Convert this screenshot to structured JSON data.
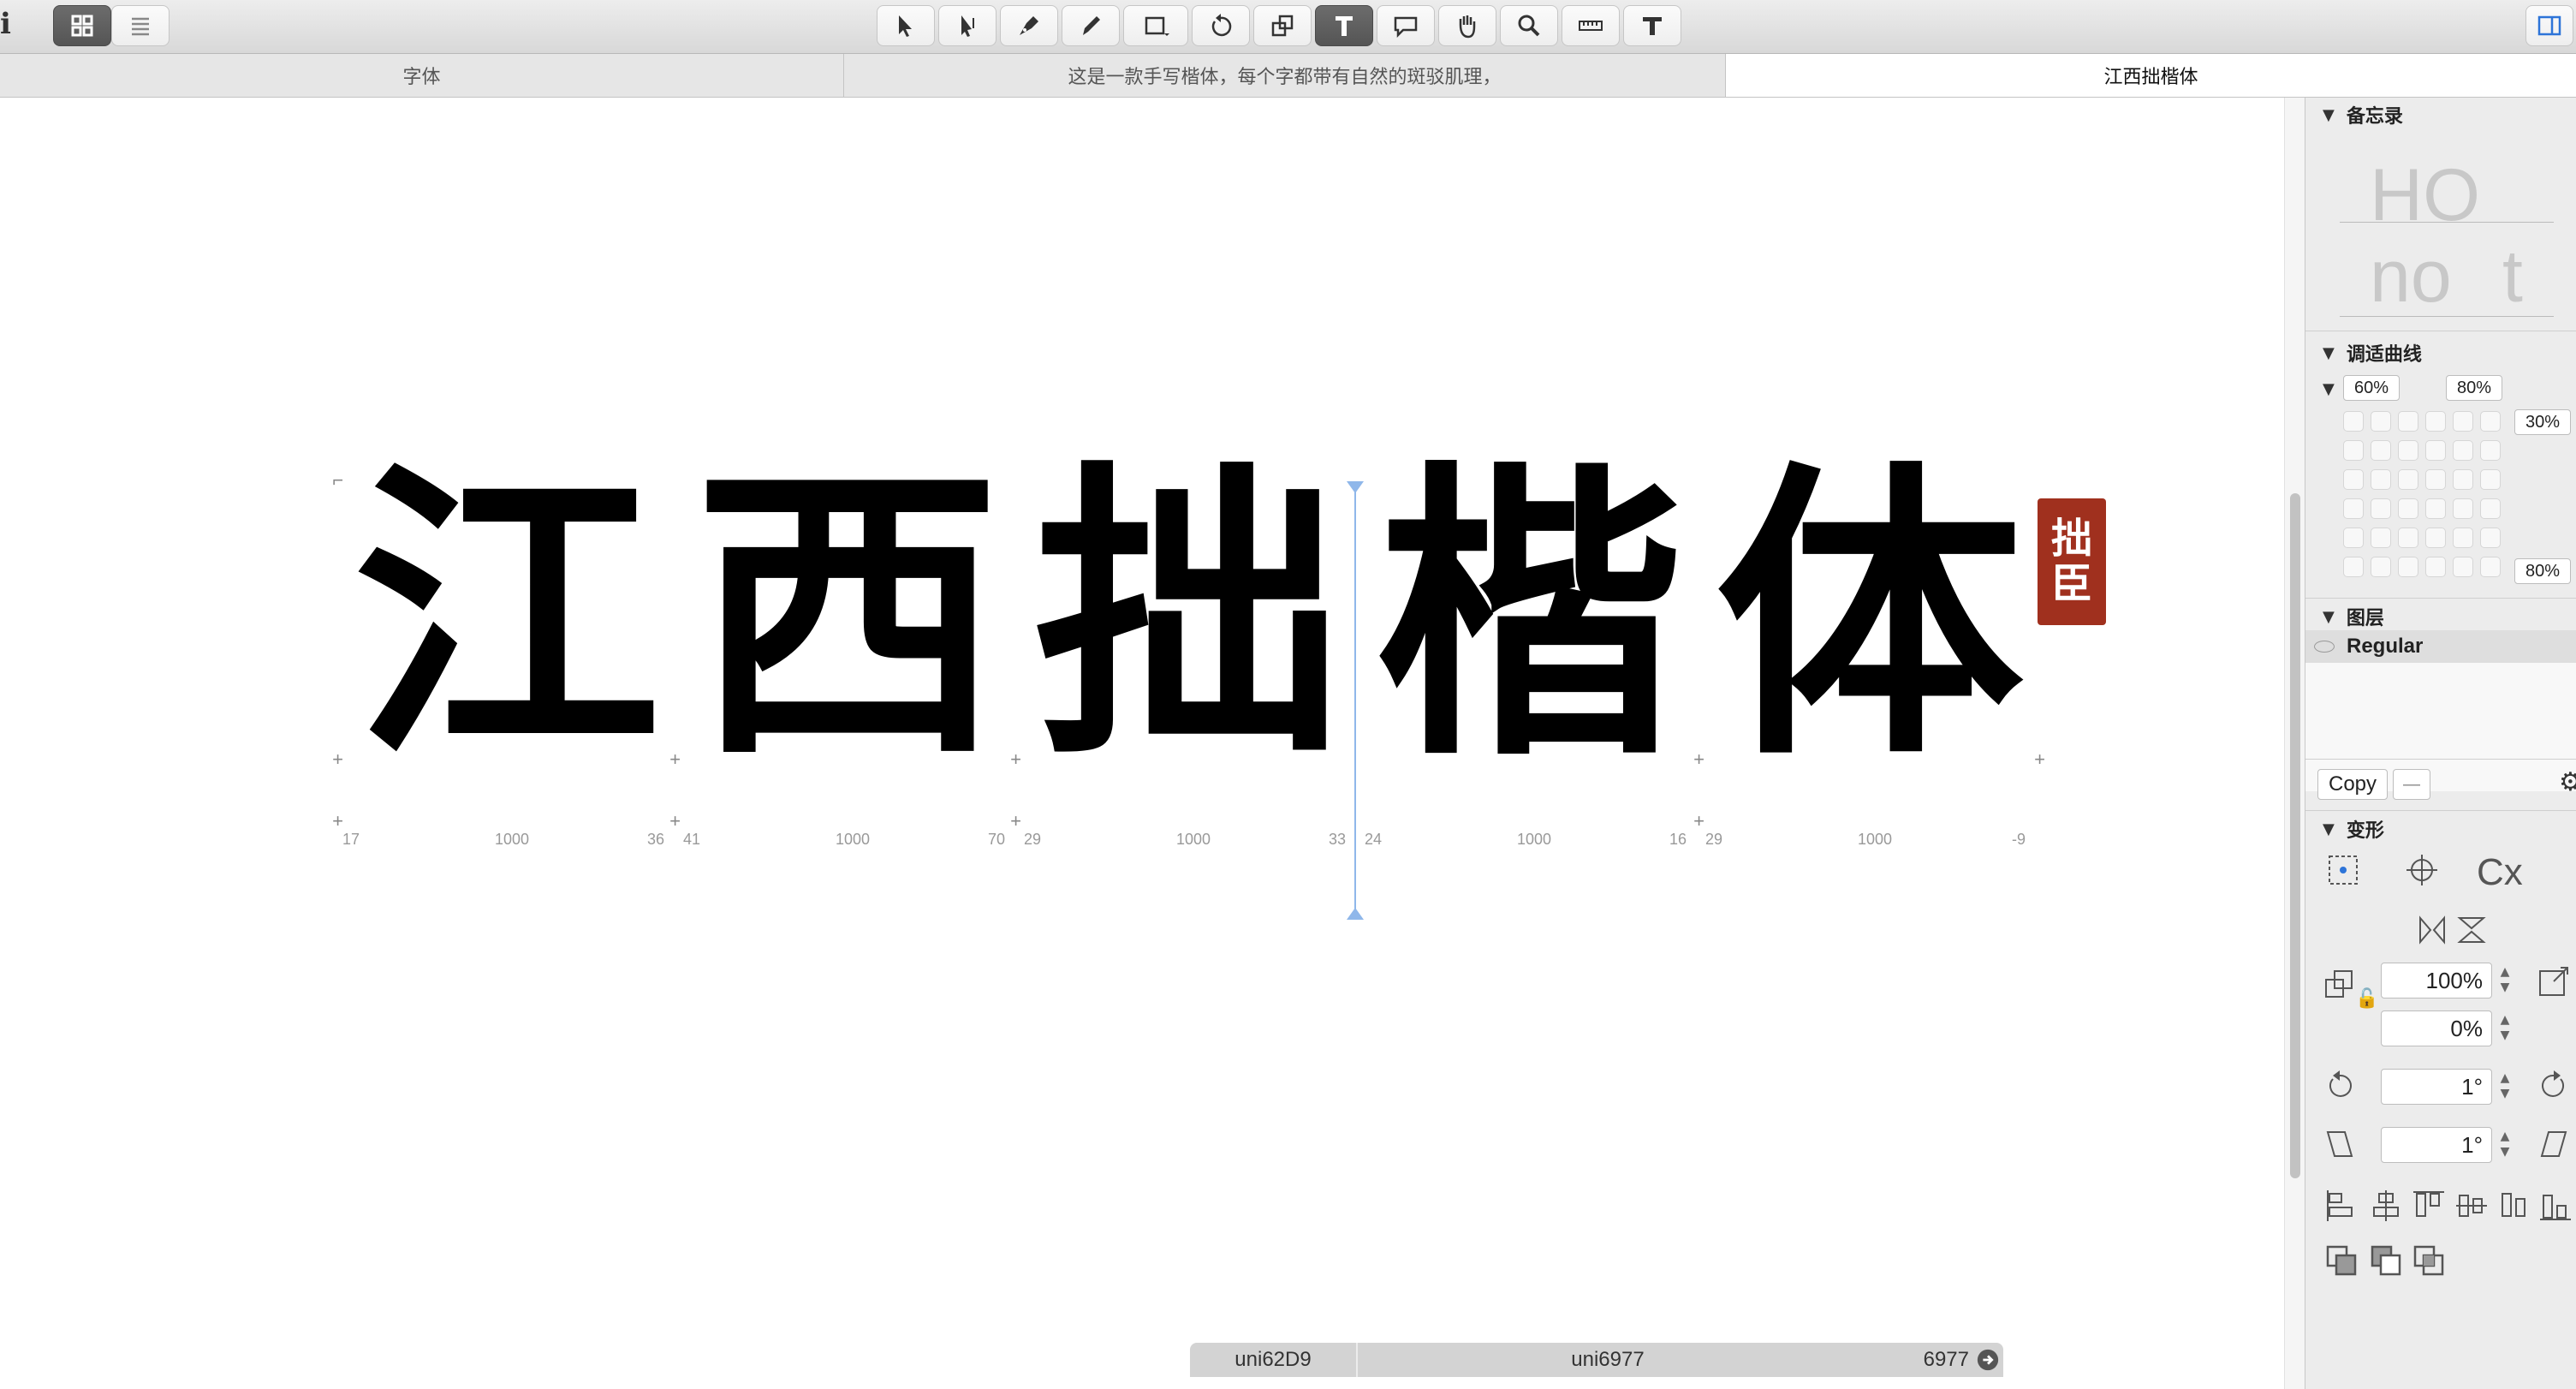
{
  "toolbar": {
    "info_glyph": "i",
    "view_buttons": [
      "grid-view",
      "list-view"
    ],
    "tools": [
      "select",
      "select-all-layers",
      "draw",
      "pencil",
      "primitives",
      "rotate",
      "scale",
      "text",
      "annotate",
      "hand",
      "zoom",
      "measure",
      "erase"
    ],
    "active_tool": "text"
  },
  "tabs": [
    {
      "label": "字体"
    },
    {
      "label": "这是一款手写楷体，每个字都带有自然的斑驳肌理，"
    },
    {
      "label": "江西拙楷体"
    }
  ],
  "canvas": {
    "glyphs": [
      "江",
      "西",
      "拙",
      "楷",
      "体"
    ],
    "metrics": [
      {
        "lsb": "17",
        "width": "1000",
        "rsb": "36"
      },
      {
        "lsb": "41",
        "width": "1000",
        "rsb": "70"
      },
      {
        "lsb": "29",
        "width": "1000",
        "rsb": "33"
      },
      {
        "lsb": "24",
        "width": "1000",
        "rsb": "16"
      },
      {
        "lsb": "29",
        "width": "1000",
        "rsb": "-9"
      }
    ],
    "seal_text": [
      "拙",
      "臣"
    ]
  },
  "info_strip": {
    "left_name": "uni62D9",
    "center_name": "uni6977",
    "unicode": "6977"
  },
  "panel": {
    "memo": {
      "title": "备忘录",
      "preview_text": [
        "HO",
        "no",
        "t"
      ]
    },
    "curves": {
      "title": "调适曲线",
      "top_left": "60%",
      "top_right": "80%",
      "right_top": "30%",
      "right_bottom": "80%"
    },
    "layers": {
      "title": "图层",
      "item": "Regular"
    },
    "copy_label": "Copy",
    "minus_label": "—",
    "transform": {
      "title": "变形",
      "scale_x": "100%",
      "scale_y": "0%",
      "rotate": "1°",
      "slant": "1°"
    }
  }
}
